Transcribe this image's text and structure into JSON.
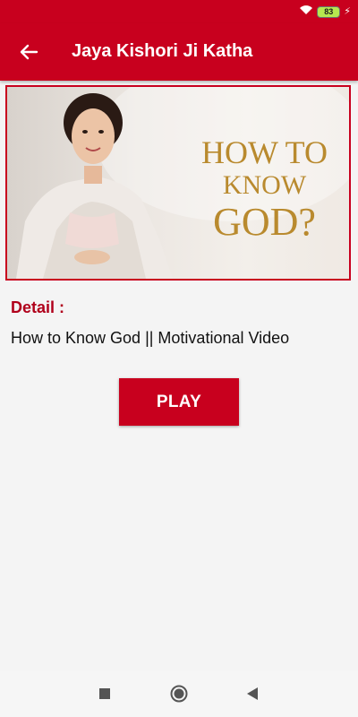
{
  "status_bar": {
    "battery_level": "83",
    "icons": [
      "wifi-icon",
      "battery-icon",
      "charging-icon"
    ]
  },
  "app_bar": {
    "title": "Jaya Kishori Ji Katha",
    "back_icon": "arrow-left-icon"
  },
  "thumbnail": {
    "line1": "HOW TO",
    "line2": "KNOW",
    "line3": "GOD?"
  },
  "detail": {
    "label": "Detail :",
    "text": "How to Know God || Motivational Video"
  },
  "play_button": {
    "label": "PLAY"
  },
  "nav_bar": {
    "icons": [
      "recents-square-icon",
      "home-circle-icon",
      "back-triangle-icon"
    ]
  },
  "colors": {
    "brand": "#c8001e",
    "detail_label": "#b0001b",
    "thumbnail_text": "#b98a2e"
  }
}
